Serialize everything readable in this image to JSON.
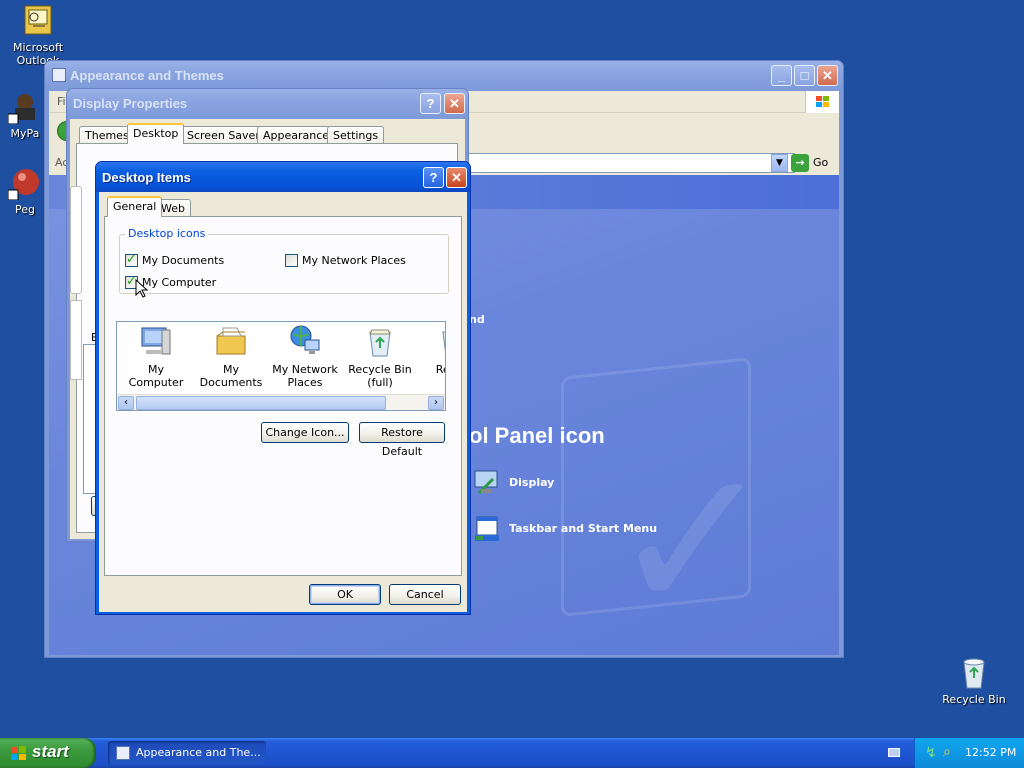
{
  "desktop": {
    "icons": [
      {
        "label": "Microsoft Outlook",
        "icon": "outlook-icon"
      },
      {
        "label": "MyPa",
        "icon": "mypa-icon"
      },
      {
        "label": "Peg",
        "icon": "peg-icon"
      },
      {
        "label": "Recycle Bin",
        "icon": "recycle-bin-icon"
      }
    ]
  },
  "appearance_window": {
    "title": "Appearance and Themes",
    "menu_partial": "Fi",
    "address_partial": "Ad",
    "go_label": "Go",
    "heading_partial": "ol Panel icon",
    "side_partial": "nd",
    "tasks": [
      {
        "label": "Display",
        "icon": "display-icon"
      },
      {
        "label": "Taskbar and Start Menu",
        "icon": "taskbar-icon"
      }
    ]
  },
  "display_properties": {
    "title": "Display Properties",
    "tabs": [
      "Themes",
      "Desktop",
      "Screen Saver",
      "Appearance",
      "Settings"
    ],
    "selected_tab": "Desktop",
    "partial_label": "B"
  },
  "desktop_items": {
    "title": "Desktop Items",
    "tabs": [
      "General",
      "Web"
    ],
    "selected_tab": "General",
    "group_label": "Desktop icons",
    "checkboxes": [
      {
        "label": "My Documents",
        "checked": true
      },
      {
        "label": "My Network Places",
        "checked": false
      },
      {
        "label": "My Computer",
        "checked": true
      }
    ],
    "icon_list": [
      {
        "label": "My Computer",
        "icon": "my-computer-icon"
      },
      {
        "label": "My Documents",
        "icon": "my-documents-icon"
      },
      {
        "label": "My Network Places",
        "icon": "network-places-icon"
      },
      {
        "label": "Recycle Bin (full)",
        "icon": "recycle-bin-full-icon"
      },
      {
        "label": "Rec (e",
        "icon": "recycle-bin-empty-icon"
      }
    ],
    "change_icon_label": "Change Icon...",
    "restore_default_label": "Restore Default",
    "ok_label": "OK",
    "cancel_label": "Cancel"
  },
  "taskbar": {
    "start_label": "start",
    "task_label": "Appearance and The...",
    "clock": "12:52 PM"
  },
  "colors": {
    "desktop": "#1f4fa0",
    "xp_blue": "#0a5fe0",
    "start_green": "#3c9a3e",
    "tray": "#0e8ad9"
  }
}
